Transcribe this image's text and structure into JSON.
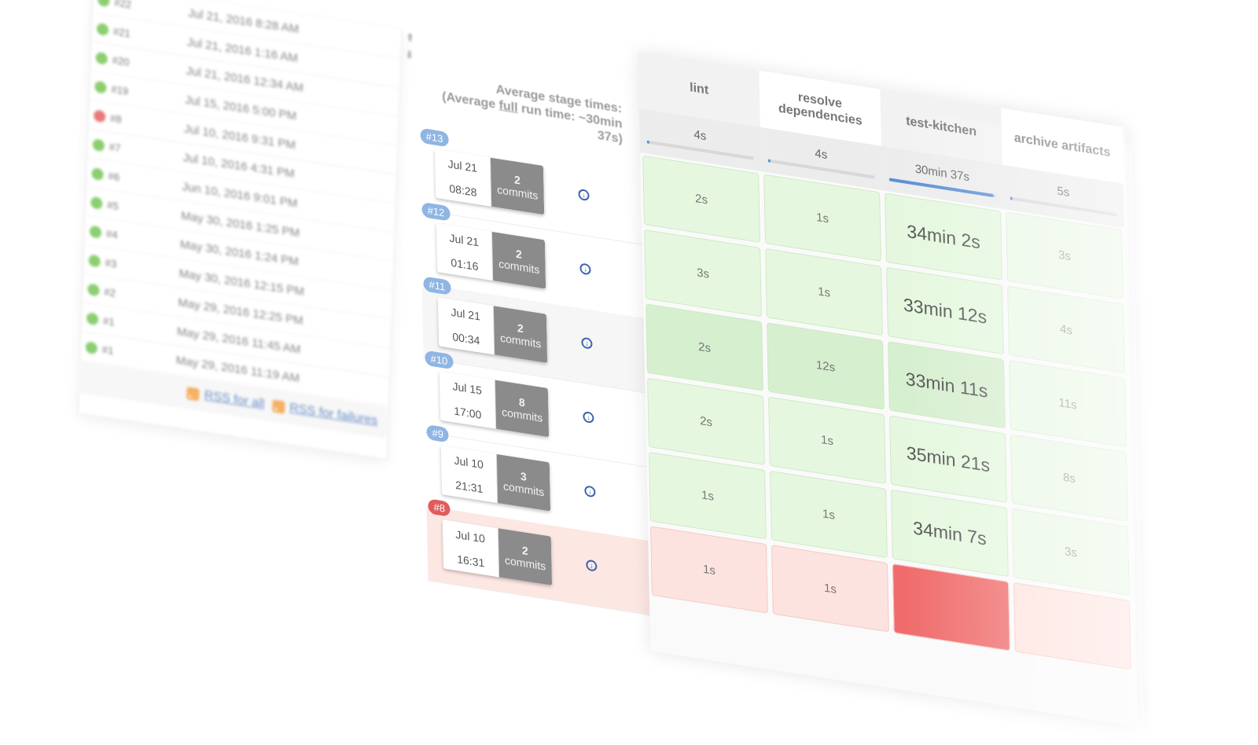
{
  "history": {
    "builds": [
      {
        "num": "#22",
        "status": "green",
        "date": "Jul 21, 2016 8:28 AM"
      },
      {
        "num": "#21",
        "status": "green",
        "date": "Jul 21, 2016 1:16 AM"
      },
      {
        "num": "#20",
        "status": "green",
        "date": "Jul 21, 2016 12:34 AM"
      },
      {
        "num": "#19",
        "status": "green",
        "date": "Jul 15, 2016 5:00 PM"
      },
      {
        "num": "#8",
        "status": "red",
        "date": "Jul 10, 2016 9:31 PM"
      },
      {
        "num": "#7",
        "status": "green",
        "date": "Jul 10, 2016 4:31 PM"
      },
      {
        "num": "#6",
        "status": "green",
        "date": "Jun 10, 2016 9:01 PM"
      },
      {
        "num": "#5",
        "status": "green",
        "date": "May 30, 2016 1:25 PM"
      },
      {
        "num": "#4",
        "status": "green",
        "date": "May 30, 2016 1:24 PM"
      },
      {
        "num": "#3",
        "status": "green",
        "date": "May 30, 2016 12:15 PM"
      },
      {
        "num": "#2",
        "status": "green",
        "date": "May 29, 2016 12:25 PM"
      },
      {
        "num": "#1",
        "status": "green",
        "date": "May 29, 2016 11:45 AM"
      },
      {
        "num": "#1",
        "status": "green",
        "date": "May 29, 2016 11:19 AM"
      }
    ],
    "rss_all": "RSS for all",
    "rss_failures": "RSS for failures"
  },
  "stage_view": {
    "avg_line1": "Average stage times:",
    "avg_line2_prefix": "(Average ",
    "avg_line2_full": "full",
    "avg_line2_suffix": " run time: ~30min",
    "avg_line3": "37s)",
    "stages": [
      {
        "name": "lint",
        "avg": "4s",
        "avg_fraction": 0.02
      },
      {
        "name": "resolve dependencies",
        "avg": "4s",
        "avg_fraction": 0.02
      },
      {
        "name": "test-kitchen",
        "avg": "30min 37s",
        "avg_fraction": 0.98
      },
      {
        "name": "archive artifacts",
        "avg": "5s",
        "avg_fraction": 0.02
      }
    ],
    "runs": [
      {
        "badge": "#13",
        "date": "Jul 21",
        "time": "08:28",
        "commits_count": "2",
        "commits_label": "commits",
        "status": "ok",
        "cells": [
          "2s",
          "1s",
          "34min 2s",
          "3s"
        ]
      },
      {
        "badge": "#12",
        "date": "Jul 21",
        "time": "01:16",
        "commits_count": "2",
        "commits_label": "commits",
        "status": "ok",
        "cells": [
          "3s",
          "1s",
          "33min 12s",
          "4s"
        ]
      },
      {
        "badge": "#11",
        "date": "Jul 21",
        "time": "00:34",
        "commits_count": "2",
        "commits_label": "commits",
        "status": "ok",
        "cells": [
          "2s",
          "12s",
          "33min 11s",
          "11s"
        ]
      },
      {
        "badge": "#10",
        "date": "Jul 15",
        "time": "17:00",
        "commits_count": "8",
        "commits_label": "commits",
        "status": "ok",
        "cells": [
          "2s",
          "1s",
          "35min 21s",
          "8s"
        ]
      },
      {
        "badge": "#9",
        "date": "Jul 10",
        "time": "21:31",
        "commits_count": "3",
        "commits_label": "commits",
        "status": "ok",
        "cells": [
          "1s",
          "1s",
          "34min 7s",
          "3s"
        ]
      },
      {
        "badge": "#8",
        "date": "Jul 10",
        "time": "16:31",
        "commits_count": "2",
        "commits_label": "commits",
        "status": "failed",
        "cells": [
          "1s",
          "1s",
          "",
          ""
        ]
      }
    ]
  }
}
